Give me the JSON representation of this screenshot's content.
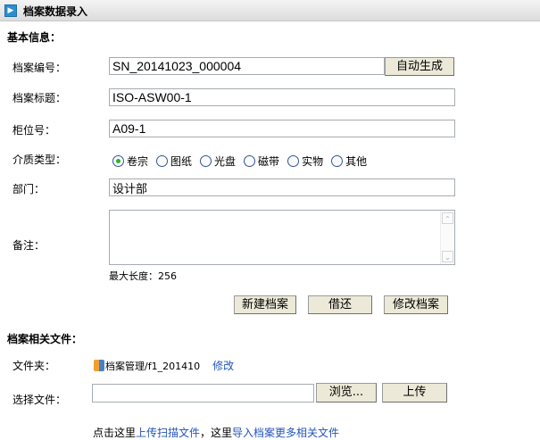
{
  "header": {
    "title": "档案数据录入"
  },
  "basic": {
    "section_title": "基本信息：",
    "archive_no": {
      "label": "档案编号：",
      "value": "SN_20141023_000004",
      "auto_button": "自动生成"
    },
    "archive_title": {
      "label": "档案标题：",
      "value": "ISO-ASW00-1"
    },
    "cabinet_no": {
      "label": "柜位号：",
      "value": "A09-1"
    },
    "media_type": {
      "label": "介质类型：",
      "options": [
        "卷宗",
        "图纸",
        "光盘",
        "磁带",
        "实物",
        "其他"
      ],
      "selected": "卷宗"
    },
    "department": {
      "label": "部门：",
      "value": "设计部"
    },
    "remark": {
      "label": "备注：",
      "value": "",
      "max_length_text": "最大长度：256"
    },
    "buttons": {
      "new": "新建档案",
      "borrow": "借还",
      "modify": "修改档案"
    }
  },
  "files": {
    "section_title": "档案相关文件：",
    "folder": {
      "label": "文件夹：",
      "path": "档案管理/f1_201410",
      "modify_link": "修改"
    },
    "choose": {
      "label": "选择文件：",
      "value": "",
      "browse": "浏览...",
      "upload": "上传"
    },
    "hint": {
      "p1": "点击这里",
      "link1": "上传扫描文件",
      "p2": "，这里",
      "link2": "导入档案更多相关文件"
    }
  }
}
